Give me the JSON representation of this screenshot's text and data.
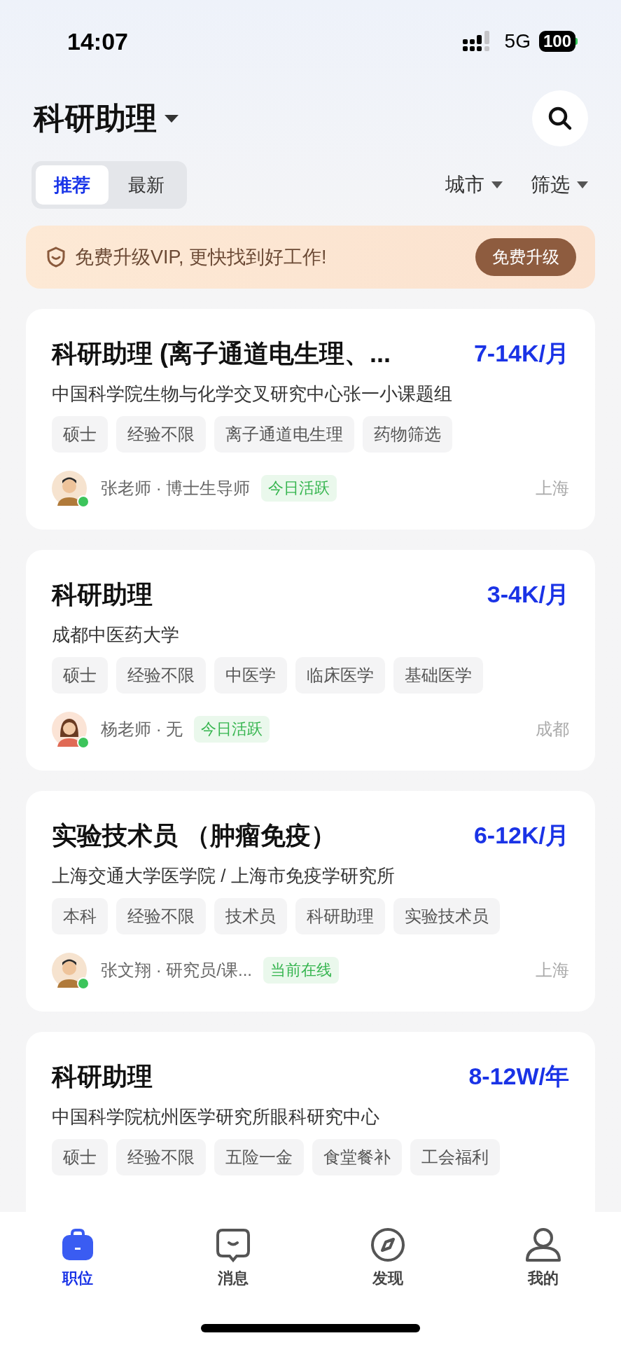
{
  "status_bar": {
    "time": "14:07",
    "network": "5G",
    "battery": "100"
  },
  "header": {
    "title": "科研助理"
  },
  "tabs": [
    {
      "label": "推荐",
      "selected": true
    },
    {
      "label": "最新",
      "selected": false
    }
  ],
  "filters": [
    "城市",
    "筛选"
  ],
  "banner": {
    "text": "免费升级VIP, 更快找到好工作!",
    "button": "免费升级"
  },
  "jobs": [
    {
      "title": "科研助理 (离子通道电生理、...",
      "salary": "7-14K/月",
      "company": "中国科学院生物与化学交叉研究中心张一小课题组",
      "tags": [
        "硕士",
        "经验不限",
        "离子通道电生理",
        "药物筛选"
      ],
      "recruiter": {
        "name": "张老师 · 博士生导师",
        "activity": "今日活跃",
        "online": true
      },
      "city": "上海"
    },
    {
      "title": "科研助理",
      "salary": "3-4K/月",
      "company": "成都中医药大学",
      "tags": [
        "硕士",
        "经验不限",
        "中医学",
        "临床医学",
        "基础医学"
      ],
      "recruiter": {
        "name": "杨老师 · 无",
        "activity": "今日活跃",
        "online": true
      },
      "city": "成都"
    },
    {
      "title": "实验技术员 （肿瘤免疫）",
      "salary": "6-12K/月",
      "company": "上海交通大学医学院 / 上海市免疫学研究所",
      "tags": [
        "本科",
        "经验不限",
        "技术员",
        "科研助理",
        "实验技术员"
      ],
      "recruiter": {
        "name": "张文翔 · 研究员/课...",
        "activity": "当前在线",
        "online": true
      },
      "city": "上海"
    },
    {
      "title": "科研助理",
      "salary": "8-12W/年",
      "company": "中国科学院杭州医学研究所眼科研究中心",
      "tags": [
        "硕士",
        "经验不限",
        "五险一金",
        "食堂餐补",
        "工会福利"
      ]
    }
  ],
  "nav": [
    {
      "label": "职位",
      "selected": true
    },
    {
      "label": "消息",
      "selected": false
    },
    {
      "label": "发现",
      "selected": false
    },
    {
      "label": "我的",
      "selected": false
    }
  ]
}
